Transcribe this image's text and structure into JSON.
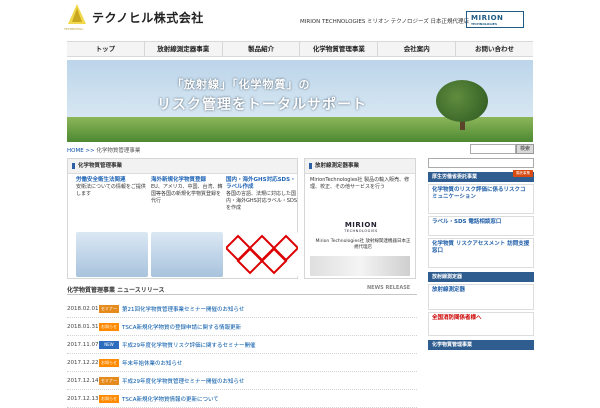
{
  "header": {
    "company": "テクノヒル株式会社",
    "logo_sub": "TECHNOHILL",
    "note": "MIRION TECHNOLOGIES ミリオン テクノロジーズ 日本正規代理店",
    "mirion": "MIRION",
    "mirion_sub": "TECHNOLOGIES"
  },
  "nav": [
    "トップ",
    "放射線測定器事業",
    "製品紹介",
    "化学物質管理事業",
    "会社案内",
    "お問い合わせ"
  ],
  "hero": {
    "line1": "「放射線」「化学物質」の",
    "line2": "リスク管理をトータルサポート"
  },
  "breadcrumb": {
    "home": "HOME >>",
    "current": "化学物質管理事業"
  },
  "site_search": {
    "button": "検索"
  },
  "panel_chem": {
    "title": "化学物質管理事業",
    "cols": [
      {
        "title": "労働安全衛生法関連",
        "text": "安衛法についての情報をご提供します"
      },
      {
        "title": "海外新規化学物質登録",
        "text": "EU、アメリカ、中国、台湾、韓国等各国の新規化学物質登録を代行"
      },
      {
        "title": "国内・海外GHS対応SDS・ラベル作成",
        "text": "各国の言語、法規に対応した国内・海外GHS対応ラベル・SDSを作成"
      }
    ]
  },
  "panel_rad": {
    "title": "放射線測定器事業",
    "desc": "MirionTechnologies社 製品の輸入販売、修理、校正、その他サービスを行う",
    "mirion": "MIRION",
    "mirion_sub": "TECHNOLOGIES",
    "rep": "Mirion Technologies社 放射線関連機器日本正規代理店"
  },
  "news": {
    "title": "化学物質管理事業 ニュースリリース",
    "sub": "NEWS RELEASE",
    "items": [
      {
        "date": "2018.02.01",
        "tag": "セミナー",
        "text": "第21回化学物質管理事業セミナー開催のお知らせ"
      },
      {
        "date": "2018.01.31",
        "tag": "お知らせ",
        "text": "TSCA新規化学物質の登録申請に関する情報更新"
      },
      {
        "date": "2017.11.07",
        "tag": "NEW",
        "text": "平成29年度化学物質リスク評価に関するセミナー開催"
      },
      {
        "date": "2017.12.22",
        "tag": "お知らせ",
        "text": "年末年始休業のお知らせ"
      },
      {
        "date": "2017.12.14",
        "tag": "セミナー",
        "text": "平成29年度化学物質管理セミナー開催のお知らせ"
      },
      {
        "date": "2017.12.13",
        "tag": "お知らせ",
        "text": "TSCA新規化学物質情報の更新について"
      }
    ]
  },
  "sidebar": {
    "head1": "厚生労働省委託事業",
    "tab": "委託事業",
    "banner1": "化学物質のリスク評価に係るリスクコミュニケーション",
    "banner2": "ラベル・SDS 電話相談窓口",
    "banner3": "化学物質 リスクアセスメント 訪問支援窓口",
    "head2": "放射線測定器",
    "banner4": "放射線測定器",
    "banner5": "全国消防関係者様へ",
    "head3": "化学物質管理事業"
  },
  "colors": {
    "nav_bg": "#f4f4f4",
    "accent": "#1f64b5",
    "tag_seminar": "#e58b1d",
    "tag_news": "#ff8a00",
    "tag_new": "#2b6dbc"
  }
}
